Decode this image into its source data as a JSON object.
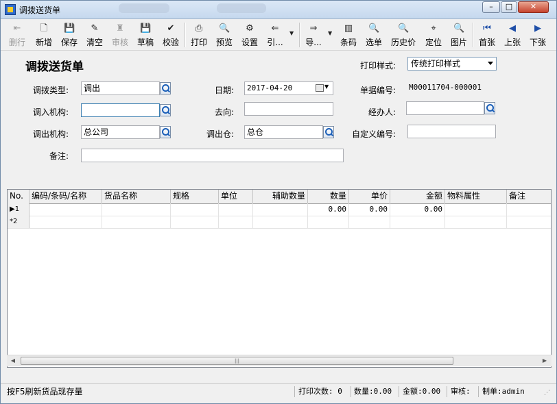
{
  "window": {
    "title": "调拨送货单",
    "minimize": "–",
    "maximize": "□",
    "close": "✕"
  },
  "toolbar": {
    "items": [
      {
        "label": "删行",
        "icon": "delete-row-icon",
        "glyph": "⇤"
      },
      {
        "label": "新增",
        "icon": "new-doc-icon",
        "glyph": "🗋"
      },
      {
        "label": "保存",
        "icon": "save-icon",
        "glyph": "💾"
      },
      {
        "label": "清空",
        "icon": "clear-brush-icon",
        "glyph": "✎"
      },
      {
        "label": "审核",
        "icon": "approve-stamp-icon",
        "glyph": "♜"
      },
      {
        "label": "草稿",
        "icon": "draft-save-icon",
        "glyph": "💾"
      },
      {
        "label": "校验",
        "icon": "check-icon",
        "glyph": "✔"
      },
      {
        "label": "打印",
        "icon": "printer-icon",
        "glyph": "⎙"
      },
      {
        "label": "预览",
        "icon": "preview-icon",
        "glyph": "🔍"
      },
      {
        "label": "设置",
        "icon": "settings-icon",
        "glyph": "⚙"
      },
      {
        "label": "引...",
        "icon": "import-icon",
        "glyph": "⇐"
      },
      {
        "label": "导...",
        "icon": "export-icon",
        "glyph": "⇒"
      },
      {
        "label": "条码",
        "icon": "barcode-icon",
        "glyph": "▥"
      },
      {
        "label": "选单",
        "icon": "select-doc-icon",
        "glyph": "🔍"
      },
      {
        "label": "历史价",
        "icon": "history-price-icon",
        "glyph": "🔍"
      },
      {
        "label": "定位",
        "icon": "binoculars-icon",
        "glyph": "⌖"
      },
      {
        "label": "图片",
        "icon": "picture-icon",
        "glyph": "🔍"
      },
      {
        "label": "首张",
        "icon": "first-record-icon",
        "glyph": "⏮"
      },
      {
        "label": "上张",
        "icon": "prev-record-icon",
        "glyph": "◀"
      },
      {
        "label": "下张",
        "icon": "next-record-icon",
        "glyph": "▶"
      }
    ]
  },
  "form": {
    "title": "调拨送货单",
    "print_style_label": "打印样式:",
    "print_style_value": "传统打印样式",
    "transfer_type_label": "调拨类型:",
    "transfer_type_value": "调出",
    "date_label": "日期:",
    "date_value": "2017-04-20",
    "bill_no_label": "单据编号:",
    "bill_no_value": "M00011704-000001",
    "in_org_label": "调入机构:",
    "in_org_value": "",
    "destination_label": "去向:",
    "destination_value": "",
    "handler_label": "经办人:",
    "handler_value": "",
    "out_org_label": "调出机构:",
    "out_org_value": "总公司",
    "out_warehouse_label": "调出仓:",
    "out_warehouse_value": "总仓",
    "custom_no_label": "自定义编号:",
    "custom_no_value": "",
    "remark_label": "备注:",
    "remark_value": ""
  },
  "grid": {
    "columns": [
      "No.",
      "编码/条码/名称",
      "货品名称",
      "规格",
      "单位",
      "辅助数量",
      "数量",
      "单价",
      "金额",
      "物料属性",
      "备注"
    ],
    "rows": [
      {
        "indicator": "▶1",
        "qty": "0.00",
        "price": "0.00",
        "amount": "0.00"
      },
      {
        "indicator": "*2",
        "qty": "",
        "price": "",
        "amount": ""
      }
    ]
  },
  "status": {
    "hint": "按F5刷新货品现存量",
    "print_count": "打印次数: 0",
    "quantity": "数量:0.00",
    "amount": "金额:0.00",
    "reviewer": "审核:",
    "creator": "制单:admin"
  }
}
